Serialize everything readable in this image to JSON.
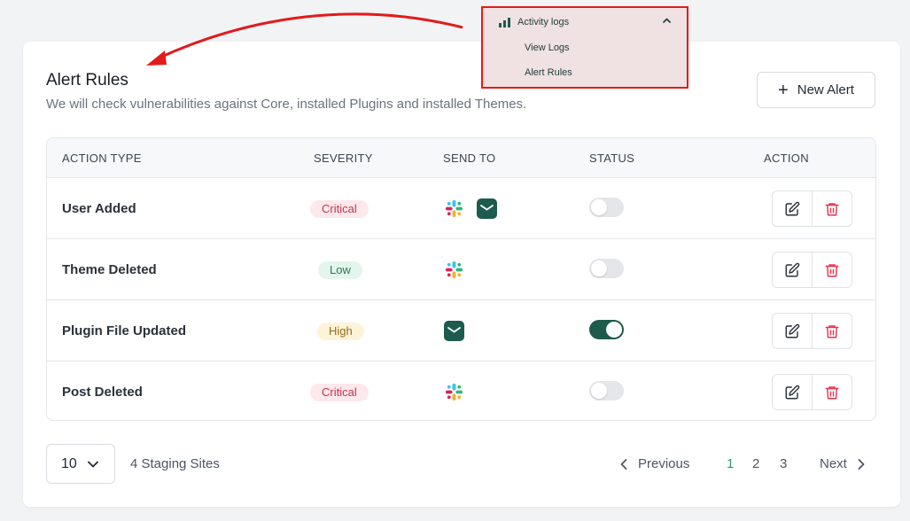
{
  "header": {
    "title": "Alert Rules",
    "subtitle": "We will check vulnerabilities against Core, installed Plugins and installed Themes.",
    "new_alert_label": "New Alert"
  },
  "table": {
    "columns": [
      "ACTION TYPE",
      "SEVERITY",
      "SEND TO",
      "STATUS",
      "ACTION"
    ],
    "rows": [
      {
        "action": "User Added",
        "severity": "Critical",
        "send_to": [
          "slack-icon",
          "mail-icon"
        ],
        "status": false
      },
      {
        "action": "Theme Deleted",
        "severity": "Low",
        "send_to": [
          "slack-icon"
        ],
        "status": false
      },
      {
        "action": "Plugin File Updated",
        "severity": "High",
        "send_to": [
          "mail-icon"
        ],
        "status": true
      },
      {
        "action": "Post Deleted",
        "severity": "Critical",
        "send_to": [
          "slack-icon"
        ],
        "status": false
      }
    ]
  },
  "footer": {
    "per_page": "10",
    "site_count": "4 Staging Sites",
    "previous_label": "Previous",
    "pages": [
      "1",
      "2",
      "3"
    ],
    "current_page": "1",
    "next_label": "Next"
  },
  "menu_callout": {
    "heading": "Activity logs",
    "items": [
      "View Logs",
      "Alert Rules"
    ]
  },
  "colors": {
    "accent": "#1d5b4e",
    "active_page": "#2e9a6b",
    "callout_border": "#e21b1b",
    "critical_bg": "#fde8ec",
    "critical_text": "#c2334d",
    "low_bg": "#e3f5ec",
    "low_text": "#2a7a55",
    "high_bg": "#fdf3d8",
    "high_text": "#9a6b12"
  }
}
